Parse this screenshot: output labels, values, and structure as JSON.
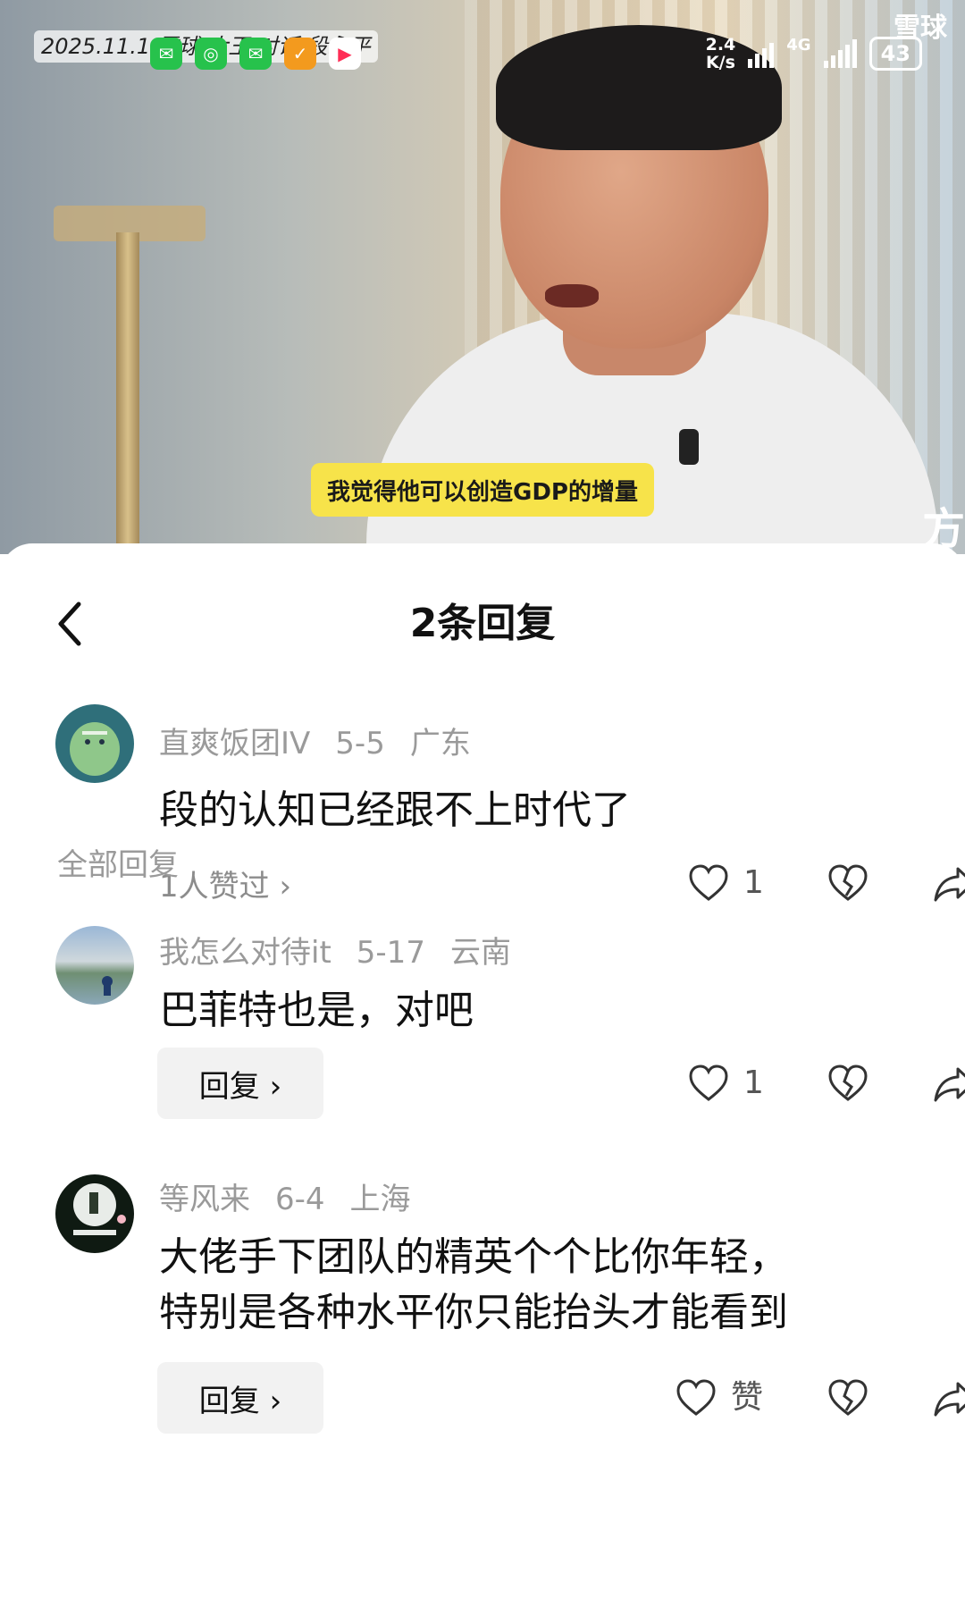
{
  "status_bar": {
    "overlay_text": "2025.11.1 雪球 大王 对话 段永平",
    "network_speed_value": "2.4",
    "network_speed_unit": "K/s",
    "network_type": "4G",
    "battery": "43",
    "app_icons": [
      "wechat-icon",
      "loop-icon",
      "wechat-icon",
      "orange-app-icon",
      "video-app-icon"
    ]
  },
  "video": {
    "brand_watermark": "雪球",
    "subtitle": "我觉得他可以创造GDP的增量",
    "corner_mark": "方"
  },
  "header": {
    "title": "2条回复"
  },
  "main_comment": {
    "user": "直爽饭团IV",
    "date": "5-5",
    "location": "广东",
    "text": "段的认知已经跟不上时代了",
    "likes_link": "1人赞过 ›",
    "like_count": "1"
  },
  "section": {
    "label": "全部回复"
  },
  "replies": [
    {
      "user": "我怎么对待it",
      "date": "5-17",
      "location": "云南",
      "text_lines": [
        "巴菲特也是，对吧"
      ],
      "reply_label": "回复 ›",
      "like_count": "1"
    },
    {
      "user": "等风来",
      "date": "6-4",
      "location": "上海",
      "text_lines": [
        "大佬手下团队的精英个个比你年轻，",
        "特别是各种水平你只能抬头才能看到"
      ],
      "reply_label": "回复 ›",
      "like_count": "赞"
    }
  ],
  "colors": {
    "subtitle_bg": "#f7e34a",
    "meta_gray": "#9a9a9a",
    "reply_btn_bg": "#f2f2f2"
  }
}
